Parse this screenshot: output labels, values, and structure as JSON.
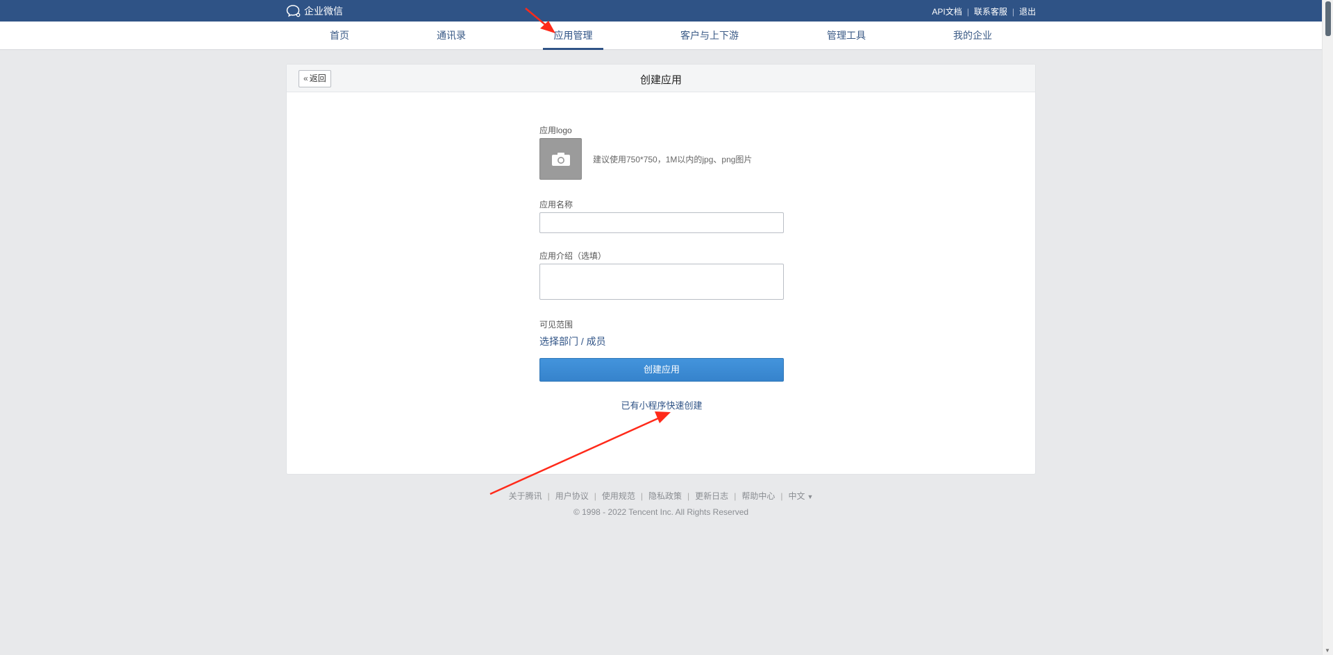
{
  "topbar": {
    "brand": "企业微信",
    "links": [
      {
        "label": "API文档"
      },
      {
        "label": "联系客服"
      },
      {
        "label": "退出"
      }
    ],
    "separator": "|"
  },
  "nav": {
    "items": [
      {
        "label": "首页"
      },
      {
        "label": "通讯录"
      },
      {
        "label": "应用管理",
        "active": true
      },
      {
        "label": "客户与上下游"
      },
      {
        "label": "管理工具"
      },
      {
        "label": "我的企业"
      }
    ]
  },
  "card": {
    "back_label": "返回",
    "title": "创建应用"
  },
  "form": {
    "logo_label": "应用logo",
    "logo_hint": "建议使用750*750，1M以内的jpg、png图片",
    "name_label": "应用名称",
    "name_value": "",
    "intro_label": "应用介绍（选填）",
    "intro_value": "",
    "scope_label": "可见范围",
    "scope_link": "选择部门 / 成员",
    "submit_label": "创建应用",
    "quick_link": "已有小程序快速创建"
  },
  "footer": {
    "links": [
      {
        "label": "关于腾讯"
      },
      {
        "label": "用户协议"
      },
      {
        "label": "使用规范"
      },
      {
        "label": "隐私政策"
      },
      {
        "label": "更新日志"
      },
      {
        "label": "帮助中心"
      }
    ],
    "separator": "|",
    "language": "中文",
    "copyright": "© 1998 - 2022 Tencent Inc. All Rights Reserved"
  },
  "colors": {
    "topbar": "#2f5386",
    "accent": "#3a8ad3",
    "link": "#2f5386",
    "annotation": "#ff2a1a"
  }
}
